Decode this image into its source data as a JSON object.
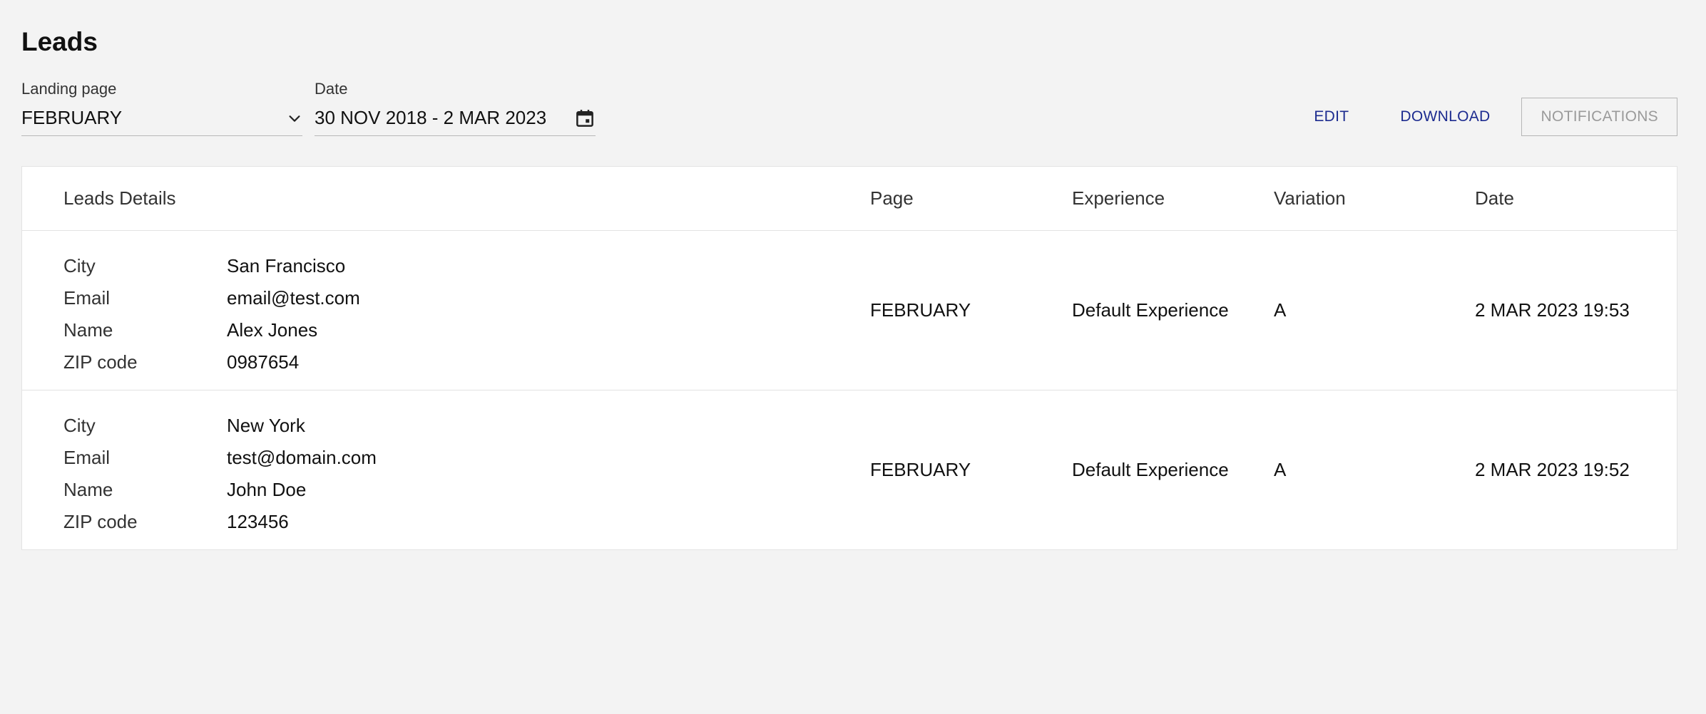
{
  "page": {
    "title": "Leads"
  },
  "filters": {
    "landing_page": {
      "label": "Landing page",
      "value": "FEBRUARY",
      "icon": "chevron-down-icon"
    },
    "date": {
      "label": "Date",
      "value": "30 NOV 2018 - 2 MAR 2023",
      "icon": "calendar-icon"
    }
  },
  "actions": {
    "edit": "EDIT",
    "download": "DOWNLOAD",
    "notifications": "NOTIFICATIONS"
  },
  "colors": {
    "background": "#f3f3f3",
    "accent": "#1c2b8f",
    "disabled": "#9a9a9a"
  },
  "table": {
    "headers": {
      "details": "Leads Details",
      "page": "Page",
      "experience": "Experience",
      "variation": "Variation",
      "date": "Date"
    },
    "rows": [
      {
        "details": [
          {
            "key": "City",
            "value": "San Francisco"
          },
          {
            "key": "Email",
            "value": "email@test.com"
          },
          {
            "key": "Name",
            "value": "Alex Jones"
          },
          {
            "key": "ZIP code",
            "value": "0987654"
          }
        ],
        "page": "FEBRUARY",
        "experience": "Default Experience",
        "variation": "A",
        "date": "2 MAR 2023 19:53"
      },
      {
        "details": [
          {
            "key": "City",
            "value": "New York"
          },
          {
            "key": "Email",
            "value": "test@domain.com"
          },
          {
            "key": "Name",
            "value": "John Doe"
          },
          {
            "key": "ZIP code",
            "value": "123456"
          }
        ],
        "page": "FEBRUARY",
        "experience": "Default Experience",
        "variation": "A",
        "date": "2 MAR 2023 19:52"
      }
    ]
  }
}
